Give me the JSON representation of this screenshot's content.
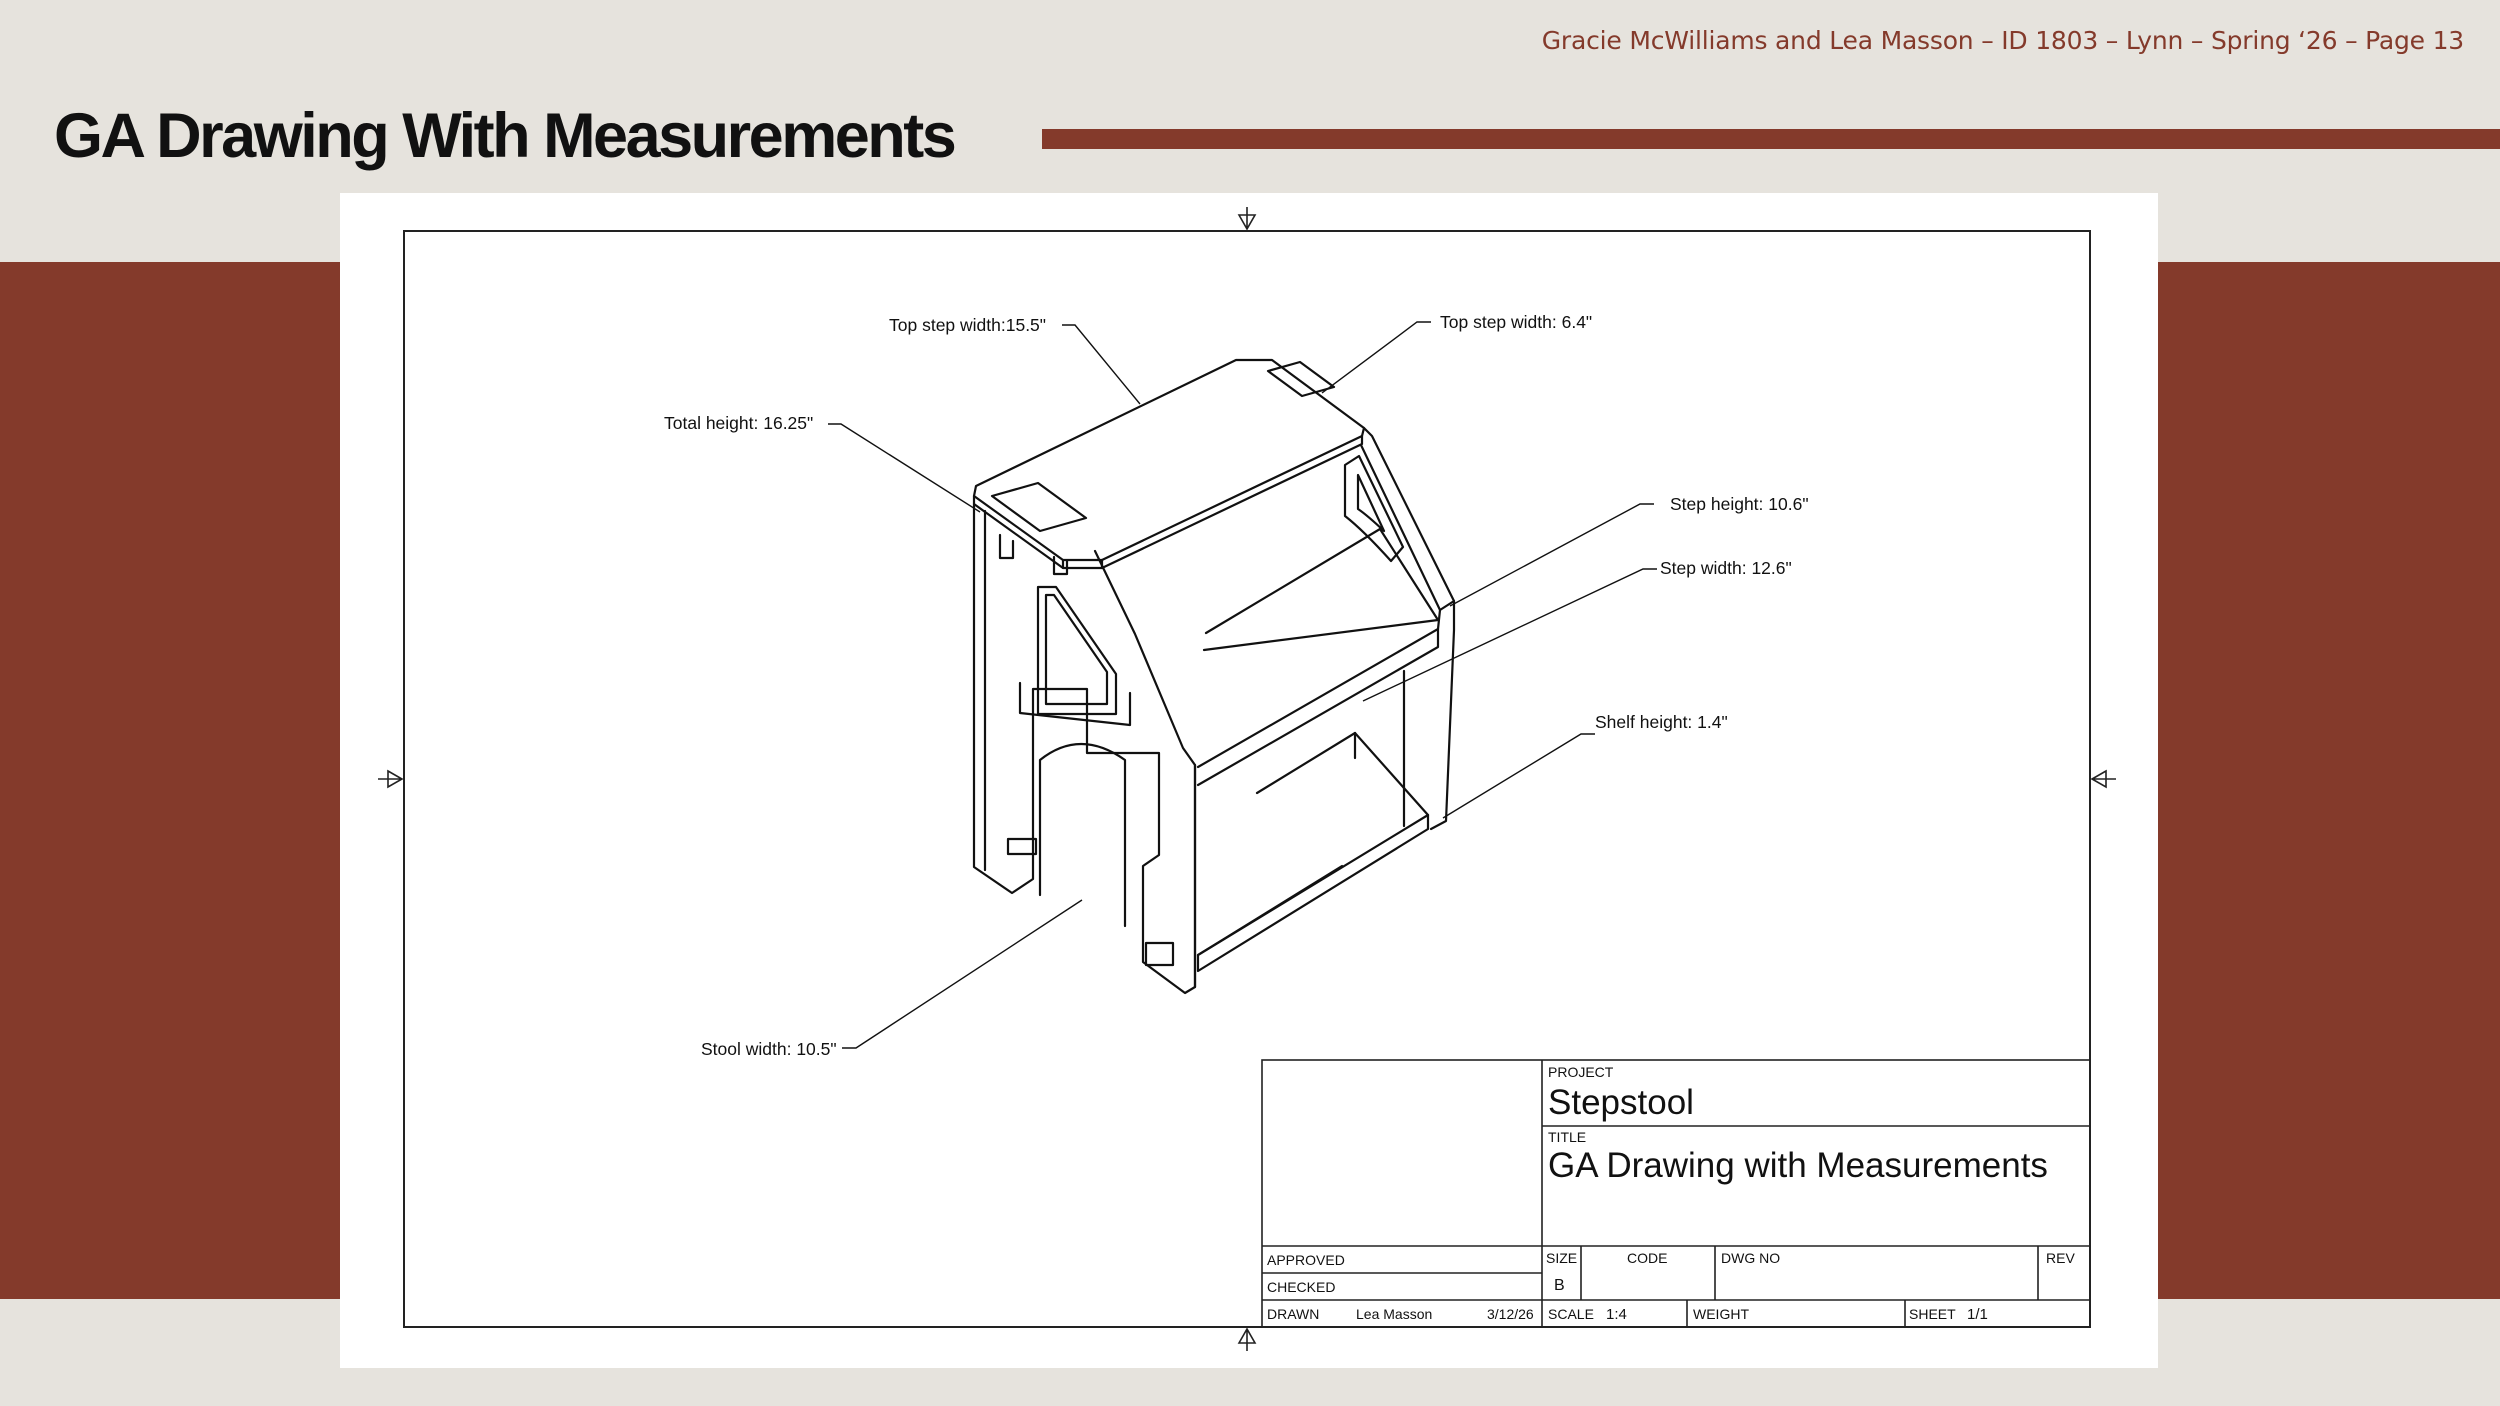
{
  "header": {
    "credit": "Gracie McWilliams and Lea Masson – ID 1803 – Lynn – Spring ‘26 – Page 13",
    "title": "GA Drawing With Measurements"
  },
  "colors": {
    "accent": "#843a2b",
    "background": "#e6e3dd",
    "sheet": "#ffffff"
  },
  "drawing": {
    "callouts": {
      "top_step_width_long": "Top step width:15.5\"",
      "top_step_width_short": "Top step width: 6.4\"",
      "total_height": "Total height: 16.25\"",
      "step_height": "Step height: 10.6\"",
      "step_width": "Step width: 12.6\"",
      "shelf_height": "Shelf height: 1.4\"",
      "stool_width": "Stool width: 10.5\""
    },
    "title_block": {
      "project_label": "PROJECT",
      "project": "Stepstool",
      "title_label": "TITLE",
      "title": "GA Drawing with Measurements",
      "approved_label": "APPROVED",
      "checked_label": "CHECKED",
      "drawn_label": "DRAWN",
      "drawn_by": "Lea Masson",
      "drawn_date": "3/12/26",
      "size_label": "SIZE",
      "size": "B",
      "code_label": "CODE",
      "dwg_no_label": "DWG NO",
      "rev_label": "REV",
      "scale_label": "SCALE",
      "scale": "1:4",
      "weight_label": "WEIGHT",
      "sheet_label": "SHEET",
      "sheet": "1/1"
    }
  }
}
